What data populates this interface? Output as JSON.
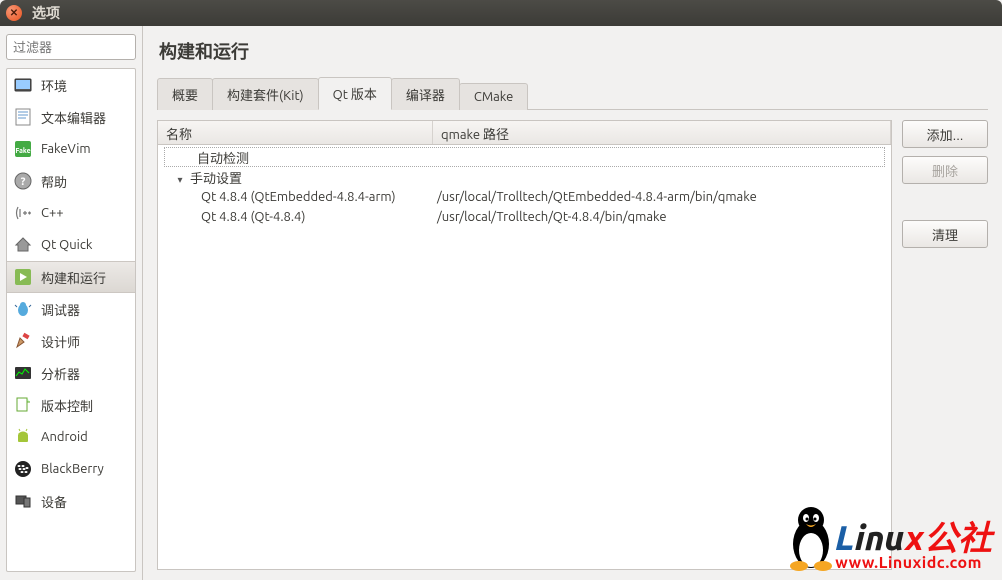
{
  "window": {
    "title": "选项"
  },
  "sidebar": {
    "filter_placeholder": "过滤器",
    "items": [
      {
        "label": "环境"
      },
      {
        "label": "文本编辑器"
      },
      {
        "label": "FakeVim"
      },
      {
        "label": "帮助"
      },
      {
        "label": "C++"
      },
      {
        "label": "Qt Quick"
      },
      {
        "label": "构建和运行"
      },
      {
        "label": "调试器"
      },
      {
        "label": "设计师"
      },
      {
        "label": "分析器"
      },
      {
        "label": "版本控制"
      },
      {
        "label": "Android"
      },
      {
        "label": "BlackBerry"
      },
      {
        "label": "设备"
      }
    ],
    "selected_index": 6
  },
  "page": {
    "title": "构建和运行",
    "tabs": [
      "概要",
      "构建套件(Kit)",
      "Qt 版本",
      "编译器",
      "CMake"
    ],
    "active_tab_index": 2
  },
  "table": {
    "headers": {
      "name": "名称",
      "path": "qmake 路径"
    },
    "groups": [
      {
        "label": "自动检测",
        "expanded": false,
        "dotted": true,
        "rows": []
      },
      {
        "label": "手动设置",
        "expanded": true,
        "rows": [
          {
            "name": "Qt 4.8.4 (QtEmbedded-4.8.4-arm)",
            "path": "/usr/local/Trolltech/QtEmbedded-4.8.4-arm/bin/qmake"
          },
          {
            "name": "Qt 4.8.4 (Qt-4.8.4)",
            "path": "/usr/local/Trolltech/Qt-4.8.4/bin/qmake"
          }
        ]
      }
    ]
  },
  "buttons": {
    "add": "添加...",
    "remove": "删除",
    "cleanup": "清理"
  },
  "watermark": {
    "text_prefix_blue": "L",
    "text_mid_black": "inu",
    "text_suffix_red": "x公社",
    "url": "www.Linuxidc.com"
  }
}
